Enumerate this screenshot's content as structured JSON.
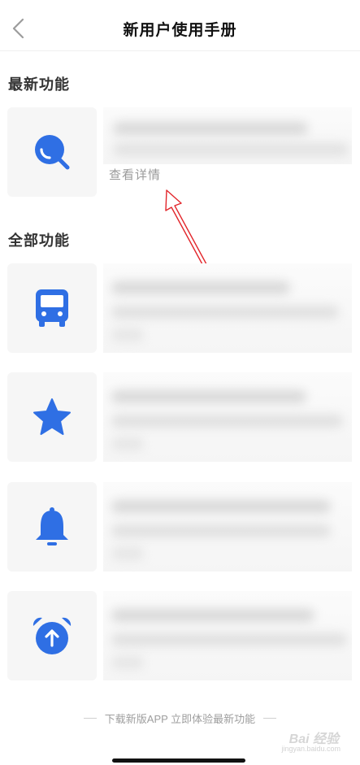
{
  "header": {
    "title": "新用户使用手册",
    "back_icon": "chevron-left-icon"
  },
  "sections": {
    "latest_title": "最新功能",
    "all_title": "全部功能"
  },
  "latest_feature": {
    "icon": "search-icon",
    "detail_link": "查看详情"
  },
  "all_features": [
    {
      "icon": "bus-icon"
    },
    {
      "icon": "star-icon"
    },
    {
      "icon": "bell-icon"
    },
    {
      "icon": "alarm-clock-icon"
    }
  ],
  "footer": {
    "note": "下载新版APP 立即体验最新功能"
  },
  "watermark": {
    "brand": "Bai 经验",
    "url": "jingyan.baidu.com"
  },
  "colors": {
    "accent": "#2f6fe4",
    "annotation_red": "#e2262b",
    "icon_bg": "#f6f6f6"
  }
}
